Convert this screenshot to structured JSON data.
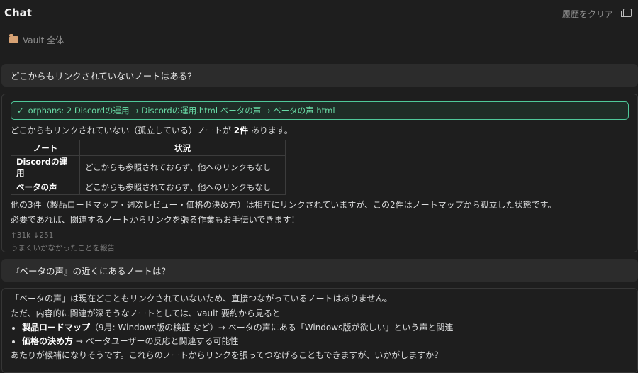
{
  "header": {
    "title": "Chat",
    "clear_label": "履歴をクリア"
  },
  "scope": {
    "label": "Vault 全体"
  },
  "messages": [
    {
      "role": "user",
      "text": "どこからもリンクされていないノートはある？"
    },
    {
      "role": "assistant",
      "tool_call": "orphans: 2 Discordの運用 → Discordの運用.html ベータの声 → ベータの声.html",
      "intro_pre": "どこからもリンクされていない（孤立している）ノートが ",
      "intro_bold": "2件",
      "intro_post": " あります。",
      "table": {
        "headers": [
          "ノート",
          "状況"
        ],
        "rows": [
          [
            "Discordの運用",
            "どこからも参照されておらず、他へのリンクもなし"
          ],
          [
            "ベータの声",
            "どこからも参照されておらず、他へのリンクもなし"
          ]
        ]
      },
      "para1": "他の3件（製品ロードマップ・週次レビュー・価格の決め方）は相互にリンクされていますが、この2件はノートマップから孤立した状態です。",
      "para2": "必要であれば、関連するノートからリンクを張る作業もお手伝いできます！",
      "tokens": "↑31k ↓251",
      "report_label": "うまくいかなかったことを報告"
    },
    {
      "role": "user",
      "text": "『ベータの声』の近くにあるノートは？"
    },
    {
      "role": "assistant",
      "line1": "「ベータの声」は現在どこともリンクされていないため、直接つながっているノートはありません。",
      "line2": "ただ、内容的に関連が深そうなノートとしては、vault 要約から見ると",
      "bullets": [
        {
          "bold": "製品ロードマップ",
          "text": "（9月: Windows版の検証 など）→ ベータの声にある「Windows版が欲しい」という声と関連"
        },
        {
          "bold": "価格の決め方",
          "text": " → ベータユーザーの反応と関連する可能性"
        }
      ],
      "line3": "あたりが候補になりそうです。これらのノートからリンクを張ってつなげることもできますが、いかがしますか？"
    }
  ],
  "colors": {
    "background": "#1e1e1e",
    "user_bubble": "#2c2c2c",
    "tool_border": "#4fc99a",
    "tool_text": "#69dba6",
    "folder": "#d7a274"
  }
}
